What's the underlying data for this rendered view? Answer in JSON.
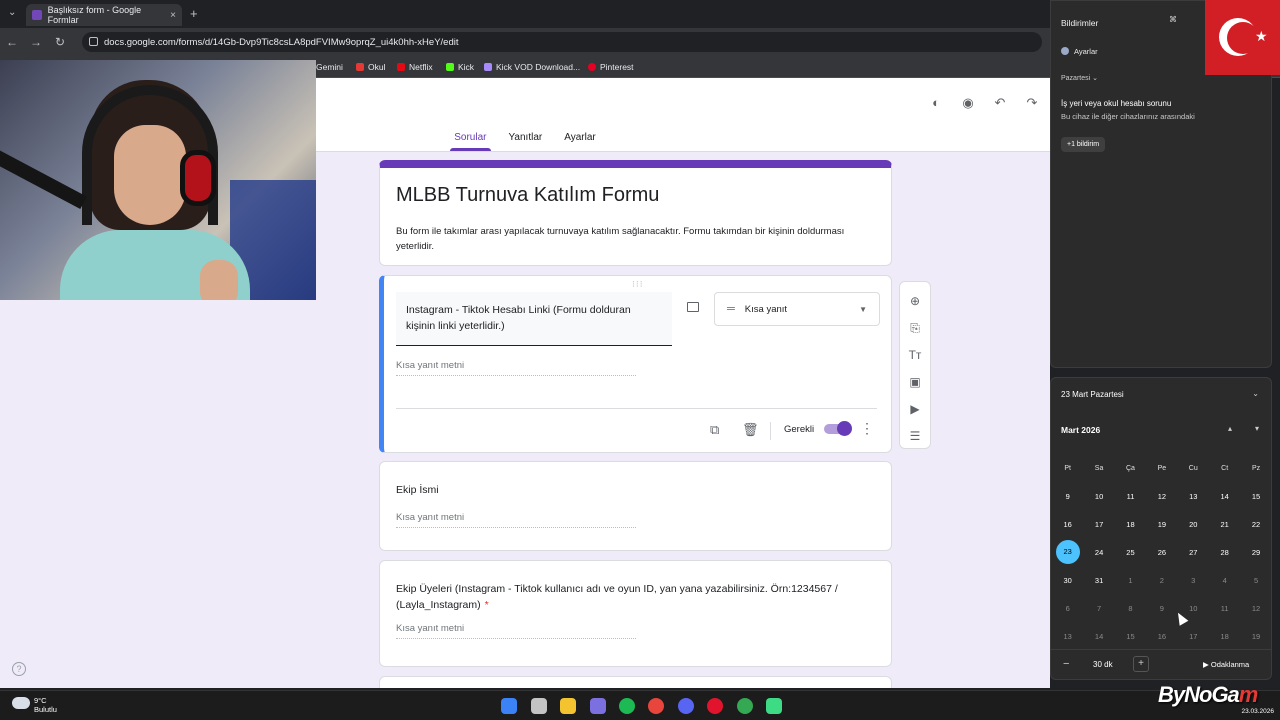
{
  "browser": {
    "tab_title": "Başlıksız form - Google Formlar",
    "url": "docs.google.com/forms/d/14Gb-Dvp9Tic8csLA8pdFVIMw9oprqZ_ui4k0hh-xHeY/edit",
    "bookmarks": [
      "Gemini",
      "Okul",
      "Netflix",
      "Kick",
      "Kick VOD Download...",
      "Pinterest"
    ]
  },
  "forms": {
    "tabs": [
      "Sorular",
      "Yanıtlar",
      "Ayarlar"
    ],
    "active_tab": "Sorular",
    "title": "MLBB Turnuva Katılım Formu",
    "description": "Bu form ile takımlar arası yapılacak turnuvaya katılım sağlanacaktır. Formu takımdan bir kişinin doldurması yeterlidir.",
    "questions": [
      {
        "text": "Instagram - Tiktok Hesabı Linki (Formu dolduran kişinin linki yeterlidir.)",
        "type": "Kısa yanıt",
        "answer_placeholder": "Kısa yanıt metni",
        "required_label": "Gerekli",
        "required": true
      },
      {
        "text": "Ekip İsmi",
        "answer_placeholder": "Kısa yanıt metni"
      },
      {
        "text": "Ekip Üyeleri (Instagram - Tiktok kullanıcı adı ve oyun ID, yan yana yazabilirsiniz. Örn:1234567 / (Layla_Instagram)",
        "required_mark": "*",
        "answer_placeholder": "Kısa yanıt metni"
      }
    ],
    "accent_color": "#673ab7"
  },
  "notifications": {
    "title": "Bildirimler",
    "settings_label": "Ayarlar",
    "day_label": "Pazartesi",
    "item_title": "İş yeri veya okul hesabı sorunu",
    "item_body": "Bu cihaz ile diğer cihazlarınız arasındaki",
    "more_label": "+1 bildirim"
  },
  "calendar": {
    "date_header": "23 Mart Pazartesi",
    "month_label": "Mart 2026",
    "weekdays": [
      "Pt",
      "Sa",
      "Ça",
      "Pe",
      "Cu",
      "Ct",
      "Pz"
    ],
    "weeks": [
      [
        "9",
        "10",
        "11",
        "12",
        "13",
        "14",
        "15"
      ],
      [
        "16",
        "17",
        "18",
        "19",
        "20",
        "21",
        "22"
      ],
      [
        "23",
        "24",
        "25",
        "26",
        "27",
        "28",
        "29"
      ],
      [
        "30",
        "31",
        "1",
        "2",
        "3",
        "4",
        "5"
      ],
      [
        "6",
        "7",
        "8",
        "9",
        "10",
        "11",
        "12"
      ],
      [
        "13",
        "14",
        "15",
        "16",
        "17",
        "18",
        "19"
      ]
    ],
    "today": "23",
    "focus_duration": "30 dk",
    "focus_label": "Odaklanma"
  },
  "taskbar": {
    "temperature": "9°C",
    "weather": "Bulutlu",
    "date": "23.03.2026"
  },
  "watermark": "ByNoGa"
}
